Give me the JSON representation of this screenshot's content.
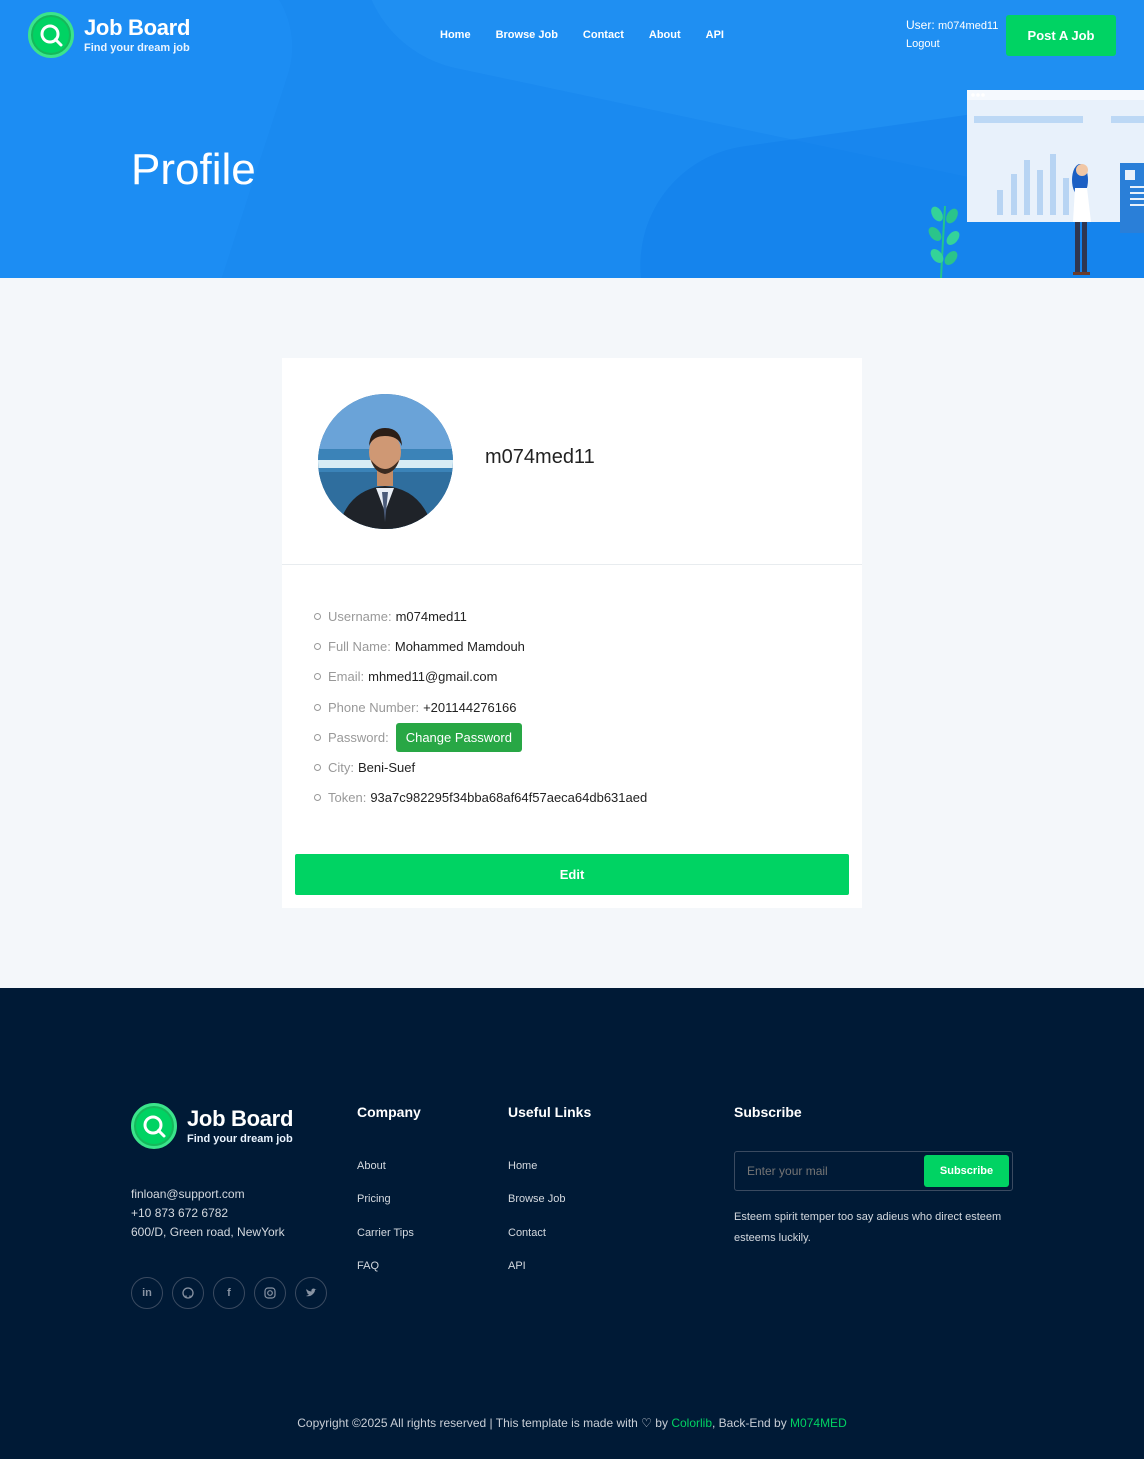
{
  "header": {
    "logo_title": "Job Board",
    "logo_subtitle": "Find your dream job",
    "nav": [
      "Home",
      "Browse Job",
      "Contact",
      "About",
      "API"
    ],
    "user_label": "User:",
    "user_name": "m074med11",
    "logout": "Logout",
    "post_job": "Post A Job"
  },
  "hero": {
    "title": "Profile"
  },
  "profile": {
    "display_name": "m074med11",
    "fields": [
      {
        "label": "Username:",
        "value": "m074med11"
      },
      {
        "label": "Full Name:",
        "value": "Mohammed Mamdouh"
      },
      {
        "label": "Email:",
        "value": "mhmed11@gmail.com"
      },
      {
        "label": "Phone Number:",
        "value": "+201144276166"
      },
      {
        "label": "Password:",
        "value": "Change Password"
      },
      {
        "label": "City:",
        "value": "Beni-Suef"
      },
      {
        "label": "Token:",
        "value": "93a7c982295f34bba68af64f57aeca64db631aed"
      }
    ],
    "edit_button": "Edit"
  },
  "footer": {
    "logo_title": "Job Board",
    "logo_subtitle": "Find your dream job",
    "contact": {
      "email": "finloan@support.com",
      "phone": "+10 873 672 6782",
      "address": "600/D, Green road, NewYork"
    },
    "socials": [
      "in",
      "gh",
      "f",
      "ig",
      "tw"
    ],
    "company": {
      "heading": "Company",
      "links": [
        "About",
        "Pricing",
        "Carrier Tips",
        "FAQ"
      ]
    },
    "useful": {
      "heading": "Useful Links",
      "links": [
        "Home",
        "Browse Job",
        "Contact",
        "API"
      ]
    },
    "subscribe": {
      "heading": "Subscribe",
      "placeholder": "Enter your mail",
      "button": "Subscribe",
      "text": "Esteem spirit temper too say adieus who direct esteem esteems luckily."
    },
    "copyright_pre": "Copyright ©2025 All rights reserved | This template is made with",
    "copyright_by": "by",
    "colorlib": "Colorlib",
    "backend_label": ", Back-End by",
    "backend_name": "M074MED"
  },
  "colors": {
    "primary_blue": "#1a8af0",
    "accent_green": "#00d363",
    "footer_bg": "#001a36",
    "change_password_green": "#28a745"
  }
}
